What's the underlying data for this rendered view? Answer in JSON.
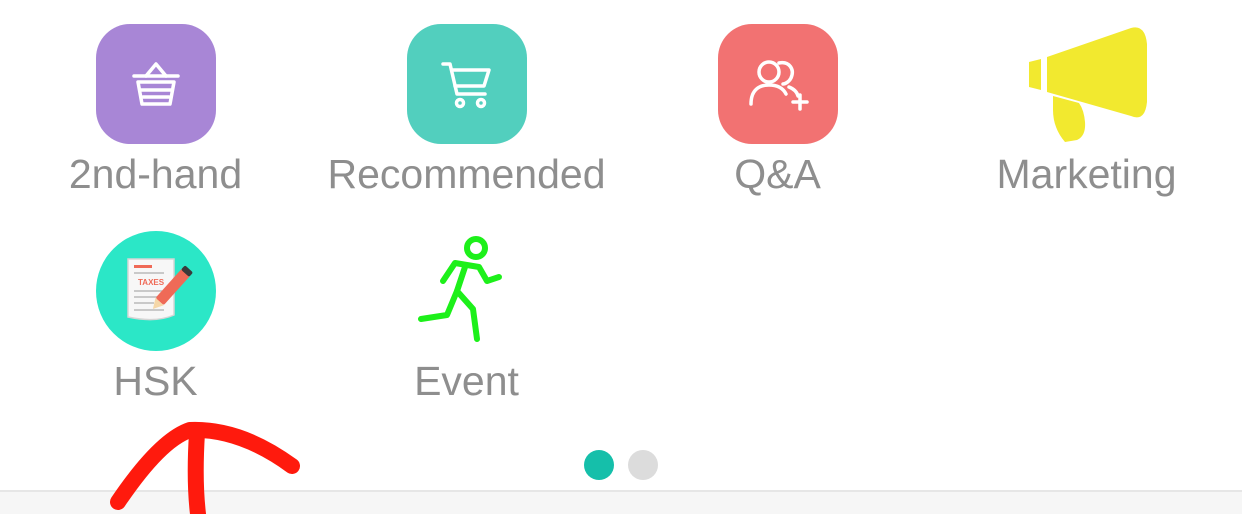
{
  "grid": {
    "items": [
      {
        "label": "2nd-hand",
        "icon": "shopping-basket-icon",
        "bg": "#a886d6"
      },
      {
        "label": "Recommended",
        "icon": "shopping-cart-icon",
        "bg": "#52cfbe"
      },
      {
        "label": "Q&A",
        "icon": "add-users-icon",
        "bg": "#f27272"
      },
      {
        "label": "Marketing",
        "icon": "megaphone-icon",
        "color": "#f2e92f"
      },
      {
        "label": "HSK",
        "icon": "taxes-document-icon",
        "bg": "#2be7c7",
        "icon_text": "TAXES"
      },
      {
        "label": "Event",
        "icon": "running-person-icon",
        "color": "#1df01a"
      }
    ]
  },
  "pager": {
    "active_color": "#15bfaa",
    "inactive_color": "#dcdcdc",
    "current_page": 1,
    "total_pages": 2
  },
  "annotation": {
    "color": "#ff1a0d",
    "icon": "red-hand-drawn-arrow-icon"
  }
}
